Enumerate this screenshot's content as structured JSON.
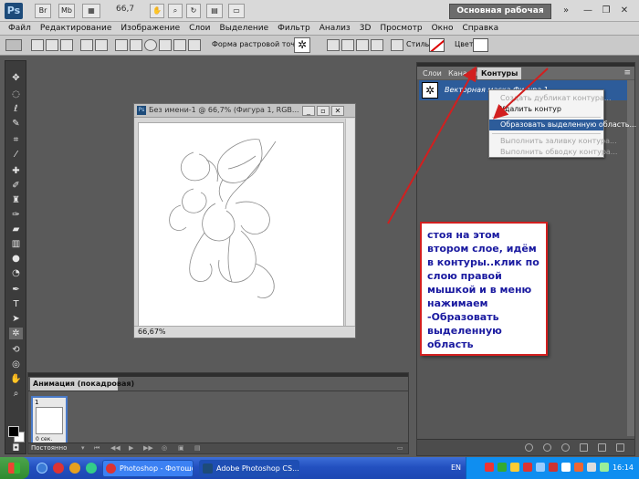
{
  "appbar": {
    "logo": "Ps",
    "btn_br": "Br",
    "btn_mb": "Mb",
    "zoom": "66,7",
    "workspace": "Основная рабочая среда"
  },
  "menu": [
    "Файл",
    "Редактирование",
    "Изображение",
    "Слои",
    "Выделение",
    "Фильтр",
    "Анализ",
    "3D",
    "Просмотр",
    "Окно",
    "Справка"
  ],
  "options": {
    "brush_label": "Форма растровой точки:",
    "style_label": "Стиль:",
    "color_label": "Цвет:"
  },
  "document": {
    "title": "Без имени-1 @ 66,7% (Фигура 1, RGB...",
    "zoom_status": "66,67%"
  },
  "panel": {
    "tabs": [
      "Слои",
      "Каналы",
      "Контуры"
    ],
    "active_tab": "Контуры",
    "path_name": "Векторная маска Фигура 1"
  },
  "context_menu": {
    "items": [
      {
        "label": "Создать дубликат контура...",
        "state": "disabled"
      },
      {
        "label": "Удалить контур",
        "state": "enabled"
      },
      {
        "label": "Образовать выделенную область...",
        "state": "highlighted"
      },
      {
        "label": "Выполнить заливку контура...",
        "state": "disabled"
      },
      {
        "label": "Выполнить обводку контура...",
        "state": "disabled"
      }
    ]
  },
  "animation": {
    "tab_title": "Анимация (покадровая)",
    "frame_number": "1",
    "frame_delay": "0 сек.",
    "loop": "Постоянно"
  },
  "note": {
    "text": "стоя на этом втором слое, идём в контуры..клик по слою правой мышкой и в меню нажимаем -Образовать выделенную область",
    "border_color": "#d21f1f",
    "text_color": "#1a1aa0"
  },
  "taskbar": {
    "tasks": [
      "Photoshop - Фотошо...",
      "Adobe Photoshop CS..."
    ],
    "lang": "EN",
    "time": "16:14"
  },
  "colors": {
    "accent_blue": "#2d5c9a",
    "arrow_red": "#d21f1f"
  }
}
